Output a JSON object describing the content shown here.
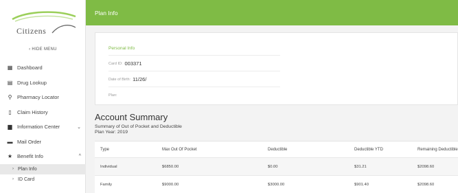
{
  "sidebar": {
    "logo_text": "Citizens",
    "hide_menu": "‹ HIDE MENU",
    "items": [
      {
        "label": "Dashboard",
        "icon": "dashboard-icon"
      },
      {
        "label": "Drug Lookup",
        "icon": "grid-icon"
      },
      {
        "label": "Pharmacy Locator",
        "icon": "location-pin-icon"
      },
      {
        "label": "Claim History",
        "icon": "document-icon"
      },
      {
        "label": "Information Center",
        "icon": "book-icon",
        "chevron": "⌄"
      },
      {
        "label": "Mail Order",
        "icon": "truck-icon"
      },
      {
        "label": "Benefit Info",
        "icon": "star-icon",
        "chevron": "^"
      }
    ],
    "subitems": [
      {
        "label": "Plan Info",
        "active": true
      },
      {
        "label": "ID Card",
        "active": false
      }
    ]
  },
  "topbar": {
    "title": "Plan Info",
    "color": "#7fbb45"
  },
  "personal_info": {
    "heading": "Personal Info",
    "card_id_label": "Card ID:",
    "card_id_value": "003371",
    "dob_label": "Date of Birth:",
    "dob_value": "11/26/",
    "plan_label": "Plan:"
  },
  "account_summary": {
    "title": "Account Summary",
    "subtitle": "Summary of Out of Pocket and Deductible",
    "plan_year": "Plan Year: 2019",
    "columns": [
      "Type",
      "Max Out Of Pocket",
      "Deductible",
      "Deductible YTD",
      "Remaining Deductible"
    ],
    "rows": [
      [
        "Individual",
        "$6850.00",
        "$0.00",
        "$31.21",
        "$2098.60"
      ],
      [
        "Family",
        "$9000.00",
        "$3000.00",
        "$901.40",
        "$2098.60"
      ]
    ]
  }
}
